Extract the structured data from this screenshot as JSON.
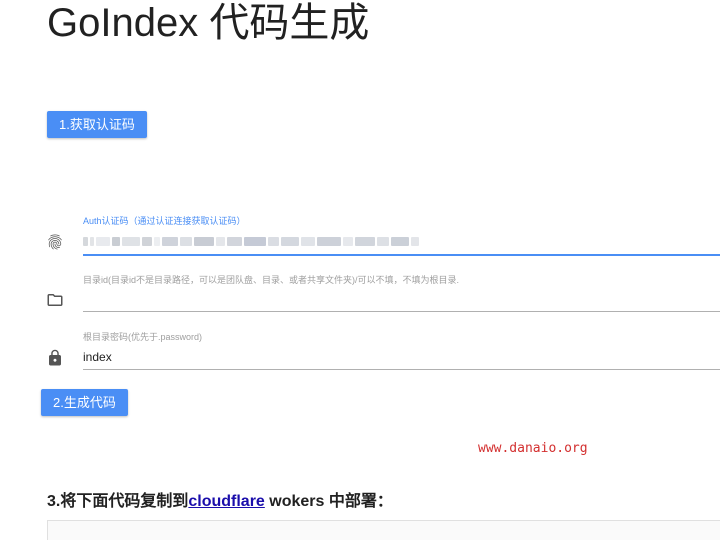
{
  "page": {
    "title": "GoIndex 代码生成"
  },
  "buttons": {
    "get_auth_code": "1.获取认证码",
    "generate_code": "2.生成代码"
  },
  "fields": {
    "auth_code": {
      "label": "Auth认证码（通过认证连接获取认证码）",
      "value": "",
      "icon": "fingerprint-icon"
    },
    "directory_id": {
      "label": "目录id(目录id不是目录路径，可以是团队盘、目录、或者共享文件夹)/可以不填，不填为根目录.",
      "value": "",
      "icon": "folder-icon"
    },
    "root_password": {
      "label": "根目录密码(优先于.password)",
      "value": "index",
      "icon": "lock-icon"
    }
  },
  "watermark": "www.danaio.org",
  "step3": {
    "prefix": "3.将下面代码复制到",
    "link": "cloudflare",
    "suffix": " wokers 中部署："
  },
  "colors": {
    "accent": "#4a8ef5",
    "watermark": "#d32f2f",
    "link": "#1a0dab"
  }
}
